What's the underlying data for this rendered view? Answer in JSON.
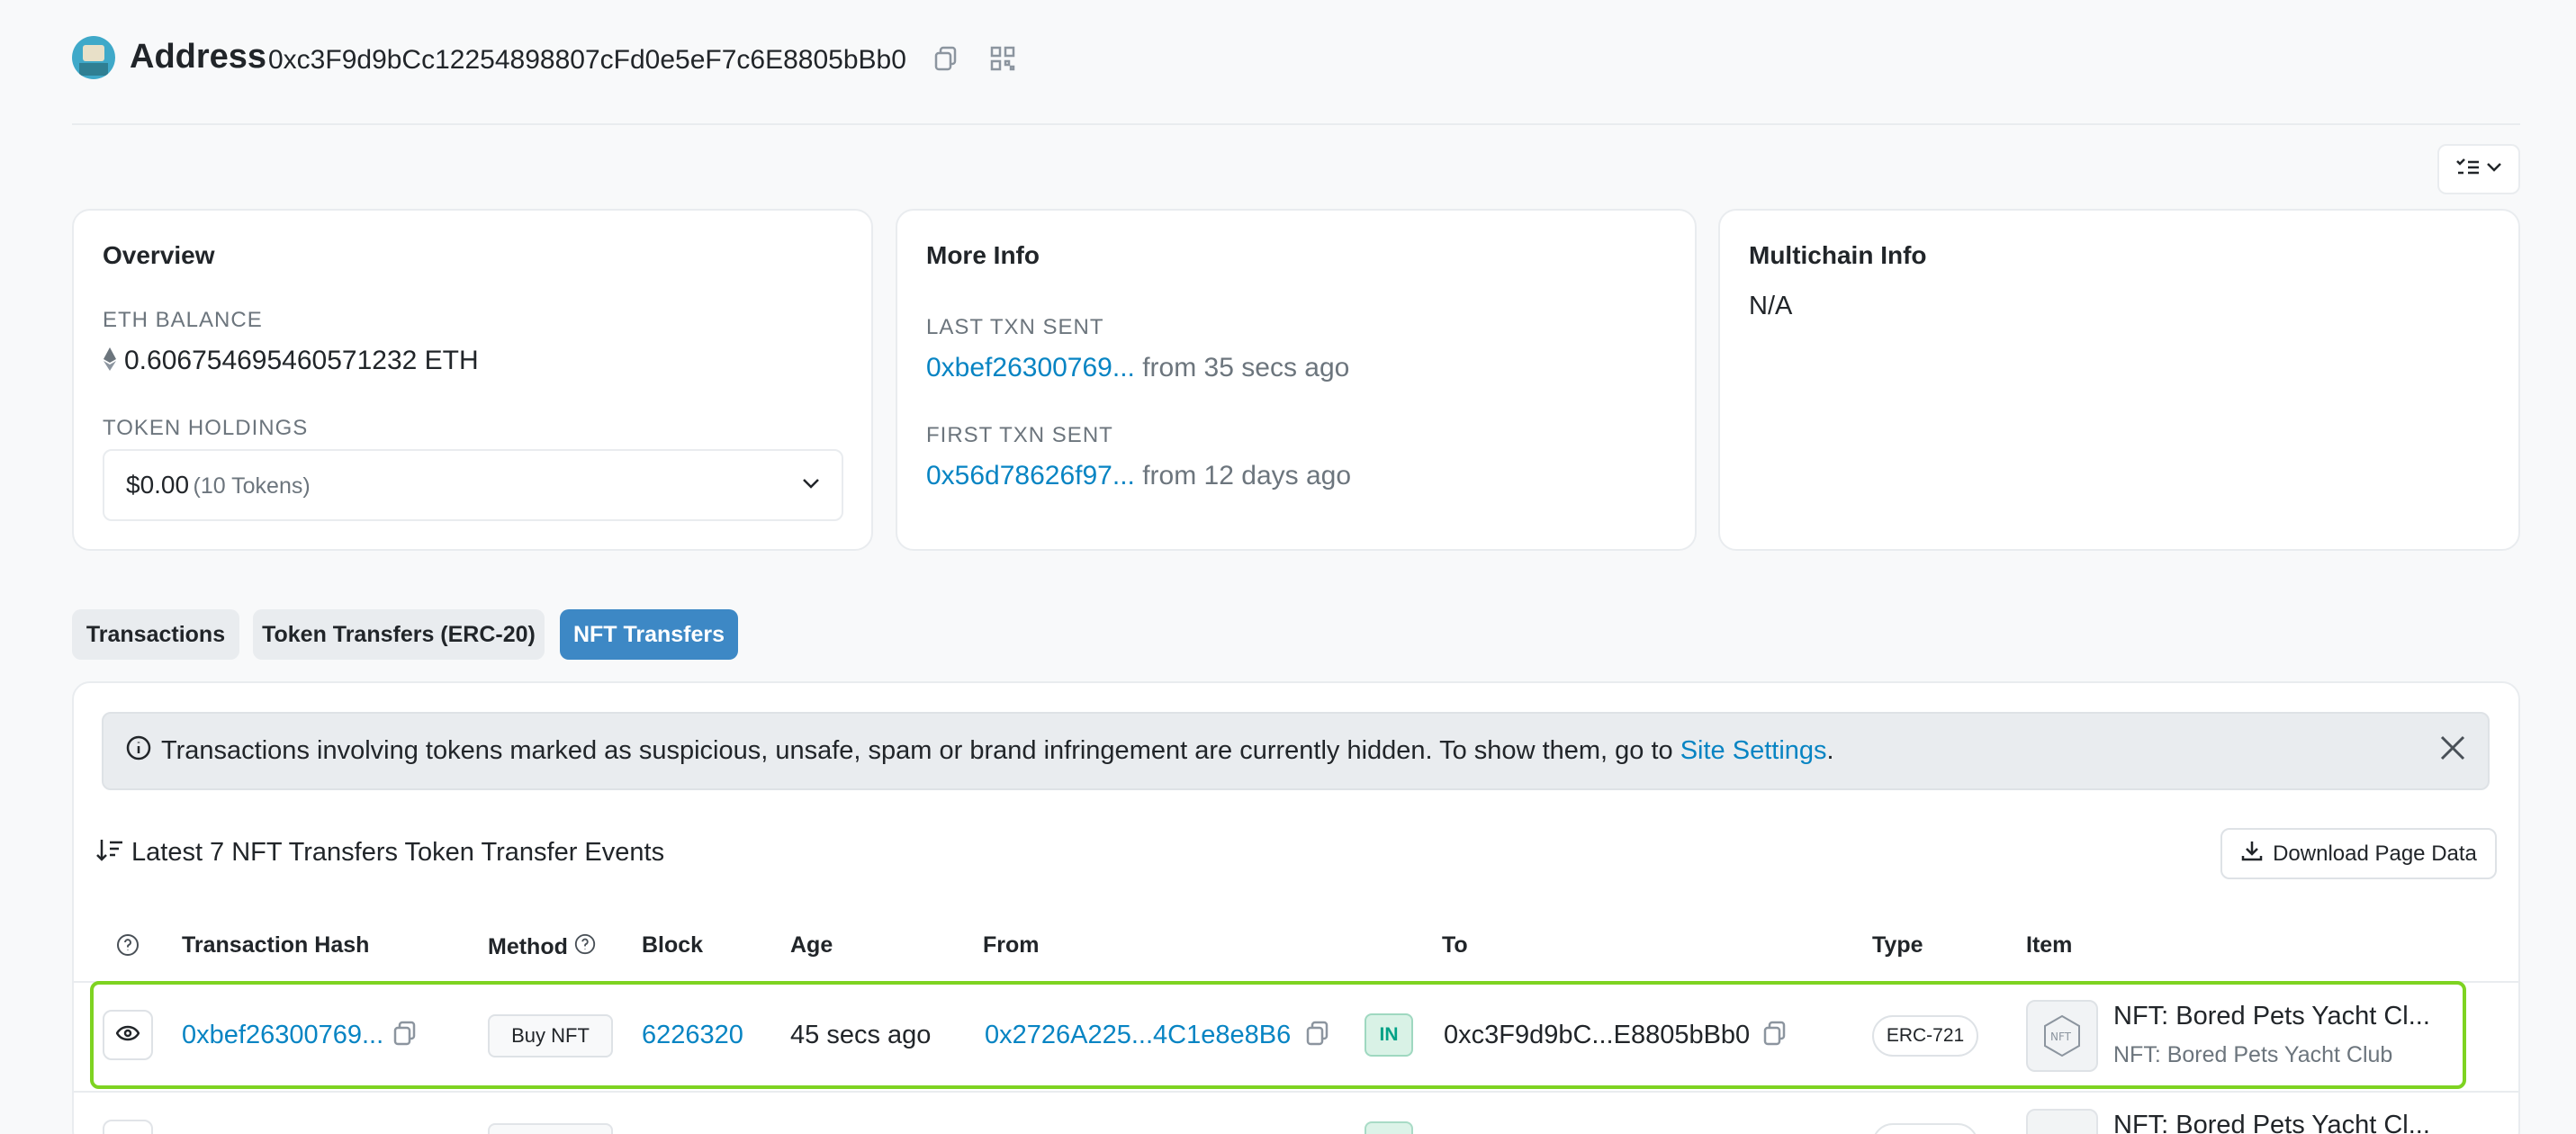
{
  "header": {
    "title": "Address",
    "address": "0xc3F9d9bCc12254898807cFd0e5eF7c6E8805bBb0"
  },
  "overview": {
    "title": "Overview",
    "eth_balance_label": "ETH BALANCE",
    "eth_balance_value": "0.606754695460571232 ETH",
    "token_holdings_label": "TOKEN HOLDINGS",
    "token_holdings_value": "$0.00",
    "token_holdings_count": "(10 Tokens)"
  },
  "more_info": {
    "title": "More Info",
    "last_txn_label": "LAST TXN SENT",
    "last_txn_hash": "0xbef26300769...",
    "last_txn_time": "from 35 secs ago",
    "first_txn_label": "FIRST TXN SENT",
    "first_txn_hash": "0x56d78626f97...",
    "first_txn_time": "from 12 days ago"
  },
  "multichain": {
    "title": "Multichain Info",
    "value": "N/A"
  },
  "tabs": [
    {
      "label": "Transactions",
      "active": false
    },
    {
      "label": "Token Transfers (ERC-20)",
      "active": false
    },
    {
      "label": "NFT Transfers",
      "active": true
    }
  ],
  "alert": {
    "text": "Transactions involving tokens marked as suspicious, unsafe, spam or brand infringement are currently hidden. To show them, go to ",
    "link": "Site Settings",
    "suffix": "."
  },
  "list": {
    "summary": "Latest 7 NFT Transfers Token Transfer Events",
    "download_label": "Download Page Data"
  },
  "table": {
    "columns": [
      "Transaction Hash",
      "Method",
      "Block",
      "Age",
      "From",
      "To",
      "Type",
      "Item"
    ],
    "rows": [
      {
        "hash": "0xbef26300769...",
        "method": "Buy NFT",
        "block": "6226320",
        "age": "45 secs ago",
        "from": "0x2726A225...4C1e8e8B6",
        "direction": "IN",
        "to": "0xc3F9d9bC...E8805bBb0",
        "type": "ERC-721",
        "item_title": "NFT: Bored Pets Yacht Cl...",
        "item_sub": "NFT: Bored Pets Yacht Club"
      },
      {
        "item_title": "NFT: Bored Pets Yacht Cl..."
      }
    ]
  },
  "colors": {
    "link": "#0784c3",
    "active_tab": "#3d88c5",
    "highlight": "#7ed321",
    "in_badge": "#00a186"
  },
  "icons": [
    "copy-icon",
    "qr-code-icon",
    "list-view-icon",
    "chevron-down-icon",
    "ethereum-icon",
    "info-icon",
    "close-icon",
    "sort-icon",
    "download-icon",
    "help-icon",
    "eye-icon",
    "nft-icon"
  ]
}
